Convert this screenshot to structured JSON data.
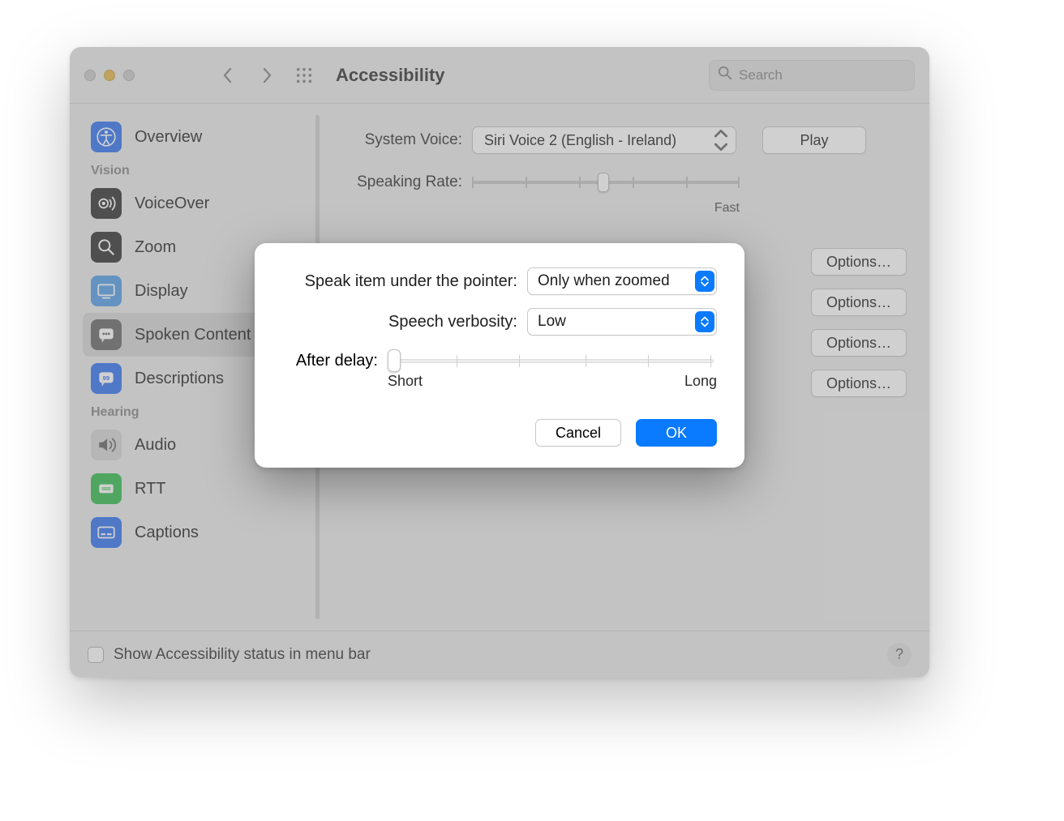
{
  "window_title": "Accessibility",
  "search_placeholder": "Search",
  "sidebar": {
    "overview": "Overview",
    "header_vision": "Vision",
    "voiceover": "VoiceOver",
    "zoom": "Zoom",
    "display": "Display",
    "spoken_content": "Spoken Content",
    "descriptions": "Descriptions",
    "header_hearing": "Hearing",
    "audio": "Audio",
    "rtt": "RTT",
    "captions": "Captions"
  },
  "main": {
    "system_voice_label": "System Voice:",
    "system_voice_value": "Siri Voice 2 (English - Ireland)",
    "play_button": "Play",
    "speaking_rate_label": "Speaking Rate:",
    "speaking_rate_fast": "Fast",
    "options_button": "Options…"
  },
  "footer": {
    "show_status": "Show Accessibility status in menu bar",
    "help": "?"
  },
  "sheet": {
    "speak_pointer_label": "Speak item under the pointer:",
    "speak_pointer_value": "Only when zoomed",
    "verbosity_label": "Speech verbosity:",
    "verbosity_value": "Low",
    "delay_label": "After delay:",
    "delay_short": "Short",
    "delay_long": "Long",
    "cancel": "Cancel",
    "ok": "OK"
  }
}
